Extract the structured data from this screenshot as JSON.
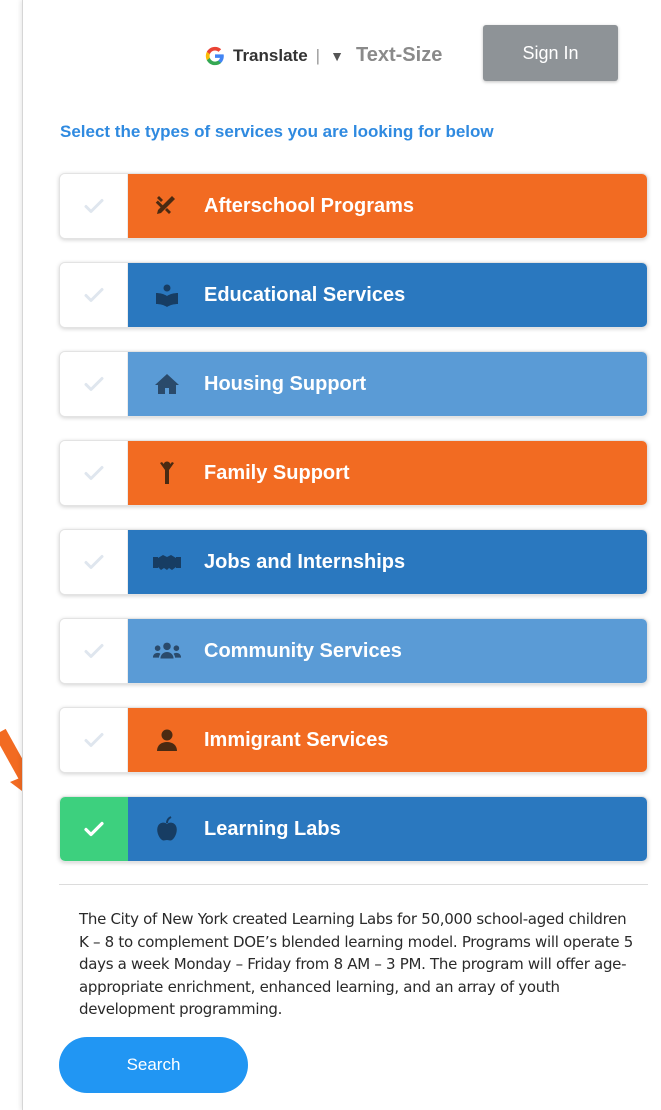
{
  "header": {
    "translate_logo": "G",
    "translate_label": "Translate",
    "translate_separator": "|",
    "translate_arrow": "▼",
    "text_size_label": "Text-Size",
    "sign_in_label": "Sign In"
  },
  "prompt": "Select the types of services you are looking for below",
  "services": [
    {
      "label": "Afterschool Programs",
      "icon": "pencil-ruler-icon",
      "color": "#f26b22",
      "checked": false
    },
    {
      "label": "Educational Services",
      "icon": "reader-icon",
      "color": "#2a78bf",
      "checked": false
    },
    {
      "label": "Housing Support",
      "icon": "house-icon",
      "color": "#5a9bd6",
      "checked": false
    },
    {
      "label": "Family Support",
      "icon": "child-icon",
      "color": "#f26b22",
      "checked": false
    },
    {
      "label": "Jobs and Internships",
      "icon": "handshake-icon",
      "color": "#2a78bf",
      "checked": false
    },
    {
      "label": "Community Services",
      "icon": "users-icon",
      "color": "#5a9bd6",
      "checked": false
    },
    {
      "label": "Immigrant Services",
      "icon": "user-icon",
      "color": "#f26b22",
      "checked": false
    },
    {
      "label": "Learning Labs",
      "icon": "apple-icon",
      "color": "#2a78bf",
      "checked": true
    }
  ],
  "description": "The City of New York created Learning Labs for 50,000 school-aged children K – 8 to complement DOE’s blended learning model. Programs will operate 5 days a week Monday – Friday from 8 AM – 3 PM. The program will offer age-appropriate enrichment, enhanced learning, and an array of youth development programming.",
  "search_label": "Search",
  "colors": {
    "orange": "#f26b22",
    "dark_blue": "#2a78bf",
    "light_blue": "#5a9bd6",
    "check_green": "#3dd07e",
    "prompt_blue": "#2f8ae0",
    "search_blue": "#2196f3",
    "sign_in_gray": "#8e9397",
    "annotation_orange": "#f26b22"
  }
}
